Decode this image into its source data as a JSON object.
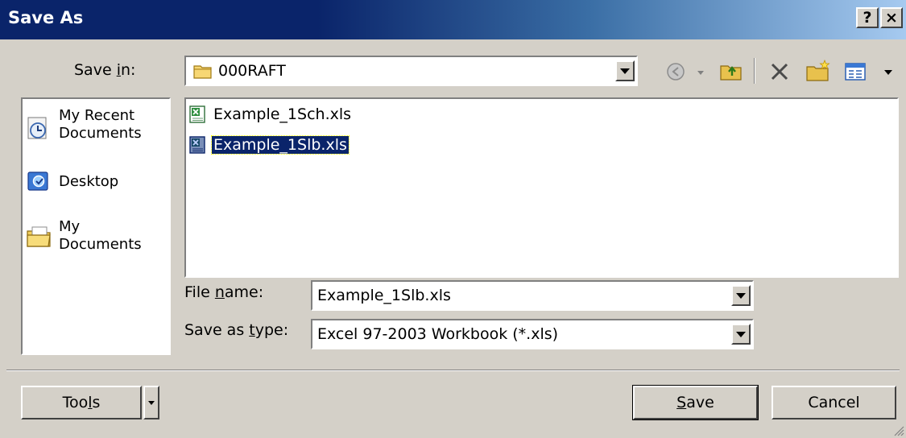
{
  "window": {
    "title": "Save As",
    "help_button": "?",
    "close_button": "×"
  },
  "toolbar": {
    "save_in_label_pre": "Save ",
    "save_in_label_u": "i",
    "save_in_label_post": "n:",
    "save_in_value": "000RAFT",
    "icons": [
      "back-icon",
      "up-folder-icon",
      "delete-icon",
      "new-folder-icon",
      "views-icon"
    ]
  },
  "places": [
    {
      "label": "My Recent Documents",
      "line1": "My Recent",
      "line2": "Documents",
      "icon": "recent-documents-icon"
    },
    {
      "label": "Desktop",
      "line1": "Desktop",
      "line2": "",
      "icon": "desktop-icon"
    },
    {
      "label": "My Documents",
      "line1": "My",
      "line2": "Documents",
      "icon": "my-documents-icon"
    }
  ],
  "files": [
    {
      "name": "Example_1Sch.xls",
      "selected": false
    },
    {
      "name": "Example_1Slb.xls",
      "selected": true
    }
  ],
  "form": {
    "file_name_label_pre": "File ",
    "file_name_label_u": "n",
    "file_name_label_post": "ame:",
    "file_name_value": "Example_1Slb.xls",
    "save_type_label_pre": "Save as ",
    "save_type_label_u": "t",
    "save_type_label_post": "ype:",
    "save_type_value": "Excel 97-2003 Workbook (*.xls)"
  },
  "buttons": {
    "tools_pre": "Too",
    "tools_u": "l",
    "tools_post": "s",
    "save_u": "S",
    "save_post": "ave",
    "cancel": "Cancel"
  }
}
